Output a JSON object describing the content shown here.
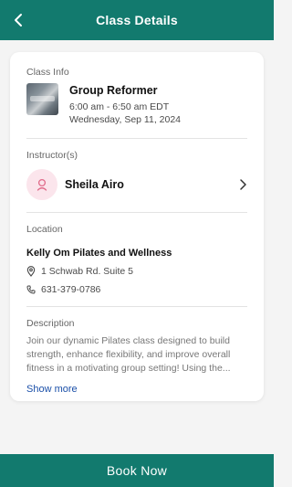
{
  "header": {
    "title": "Class Details",
    "back_icon": "chevron-left-icon"
  },
  "class_info": {
    "section_label": "Class Info",
    "name": "Group Reformer",
    "time": "6:00 am - 6:50 am EDT",
    "date": "Wednesday, Sep 11, 2024"
  },
  "instructor": {
    "section_label": "Instructor(s)",
    "name": "Sheila Airo",
    "avatar_icon": "person-icon",
    "chevron_icon": "chevron-right-icon"
  },
  "location": {
    "section_label": "Location",
    "name": "Kelly Om Pilates and Wellness",
    "address": "1 Schwab Rd. Suite 5",
    "phone": "631-379-0786",
    "address_icon": "map-pin-icon",
    "phone_icon": "phone-icon"
  },
  "description": {
    "section_label": "Description",
    "text": "Join our dynamic Pilates class designed to build strength, enhance flexibility, and improve overall fitness in a motivating group setting! Using the...",
    "show_more_label": "Show more"
  },
  "footer": {
    "book_label": "Book Now"
  },
  "colors": {
    "brand": "#127a6e",
    "link": "#1a4fa8",
    "avatar_bg": "#fbe5ec",
    "avatar_fg": "#e06b8a"
  }
}
